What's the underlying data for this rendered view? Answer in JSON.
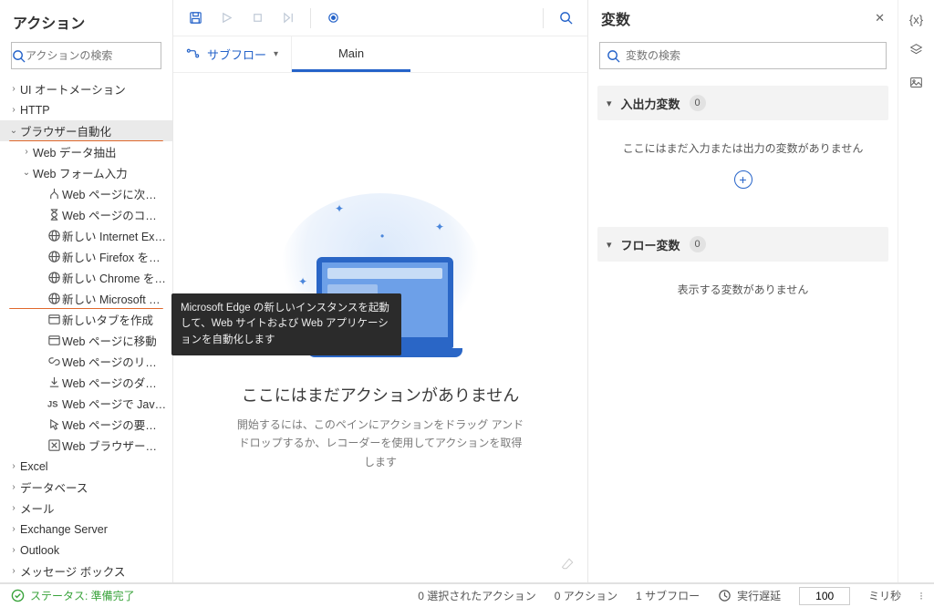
{
  "left": {
    "title": "アクション",
    "search_placeholder": "アクションの検索",
    "tree": [
      {
        "id": "ui-auto",
        "label": "UI オートメーション",
        "depth": 0,
        "chev": "right"
      },
      {
        "id": "http",
        "label": "HTTP",
        "depth": 0,
        "chev": "right"
      },
      {
        "id": "browser",
        "label": "ブラウザー自動化",
        "depth": 0,
        "chev": "down",
        "underline": true,
        "selected": true
      },
      {
        "id": "web-extract",
        "label": "Web データ抽出",
        "depth": 1,
        "chev": "right"
      },
      {
        "id": "web-form",
        "label": "Web フォーム入力",
        "depth": 1,
        "chev": "down"
      },
      {
        "id": "page-contains",
        "label": "Web ページに次が含ま...",
        "depth": 2,
        "icon": "branch"
      },
      {
        "id": "page-contents",
        "label": "Web ページのコンテンツ...",
        "depth": 2,
        "icon": "hourglass"
      },
      {
        "id": "new-ie",
        "label": "新しい Internet Explor...",
        "depth": 2,
        "icon": "globe"
      },
      {
        "id": "new-ff",
        "label": "新しい Firefox を起動する",
        "depth": 2,
        "icon": "globe"
      },
      {
        "id": "new-chrome",
        "label": "新しい Chrome を起動...",
        "depth": 2,
        "icon": "globe"
      },
      {
        "id": "new-edge",
        "label": "新しい Microsoft Edge...",
        "depth": 2,
        "icon": "globe",
        "underline": true
      },
      {
        "id": "new-tab",
        "label": "新しいタブを作成",
        "depth": 2,
        "icon": "window"
      },
      {
        "id": "goto",
        "label": "Web ページに移動",
        "depth": 2,
        "icon": "window"
      },
      {
        "id": "click-link",
        "label": "Web ページのリンクをク...",
        "depth": 2,
        "icon": "link"
      },
      {
        "id": "download",
        "label": "Web ページのダウンロード...",
        "depth": 2,
        "icon": "download"
      },
      {
        "id": "run-js",
        "label": "Web ページで JavaScrip...",
        "depth": 2,
        "icon": "js"
      },
      {
        "id": "hover",
        "label": "Web ページの要素にマウ...",
        "depth": 2,
        "icon": "cursor"
      },
      {
        "id": "close-browser",
        "label": "Web ブラウザーを閉じる",
        "depth": 2,
        "icon": "close-box"
      },
      {
        "id": "excel",
        "label": "Excel",
        "depth": 0,
        "chev": "right"
      },
      {
        "id": "database",
        "label": "データベース",
        "depth": 0,
        "chev": "right"
      },
      {
        "id": "mail",
        "label": "メール",
        "depth": 0,
        "chev": "right"
      },
      {
        "id": "exchange",
        "label": "Exchange Server",
        "depth": 0,
        "chev": "right"
      },
      {
        "id": "outlook",
        "label": "Outlook",
        "depth": 0,
        "chev": "right"
      },
      {
        "id": "msgbox",
        "label": "メッセージ ボックス",
        "depth": 0,
        "chev": "right"
      }
    ]
  },
  "toolbar": {
    "subflow": "サブフロー",
    "tab_main": "Main"
  },
  "canvas": {
    "empty_title": "ここにはまだアクションがありません",
    "empty_sub": "開始するには、このペインにアクションをドラッグ アンド ドロップするか、レコーダーを使用してアクションを取得します"
  },
  "right": {
    "title": "変数",
    "search_placeholder": "変数の検索",
    "sec1_title": "入出力変数",
    "sec1_count": "0",
    "sec1_empty": "ここにはまだ入力または出力の変数がありません",
    "sec2_title": "フロー変数",
    "sec2_count": "0",
    "sec2_empty": "表示する変数がありません"
  },
  "tooltip": {
    "text": "Microsoft Edge の新しいインスタンスを起動して、Web サイトおよび Web アプリケーションを自動化します"
  },
  "status": {
    "ready": "ステータス: 準備完了",
    "selected": "0 選択されたアクション",
    "actions": "0 アクション",
    "subflows": "1 サブフロー",
    "delay_label": "実行遅延",
    "delay_value": "100",
    "delay_unit": "ミリ秒"
  }
}
